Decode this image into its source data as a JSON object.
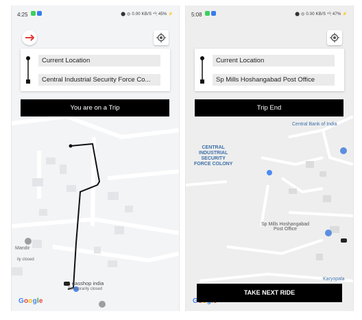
{
  "colors": {
    "accent_red": "#e53935",
    "route": "#111111",
    "blue_dot": "#4c8bf5",
    "map_bg": "#f3f4f6"
  },
  "screen1": {
    "status": {
      "time": "4:25",
      "system": "⬤ ◎ 0.00 KB/S ⁴ᴳ᷊ 45% ⚡"
    },
    "route": {
      "from": "Current Location",
      "to": "Central Industrial Security Force Co..."
    },
    "banner": "You are on a Trip",
    "map_labels": {
      "mandir": "Mandir",
      "ily_closed": "ily closed",
      "shop": "dasshop india",
      "temporarily_closed": "Temporarily closed"
    },
    "google": "Google",
    "icons": {
      "compass": "compass-icon",
      "locate": "my-location-icon"
    }
  },
  "screen2": {
    "status": {
      "time": "5:08",
      "system": "⬤ ◎ 0.00 KB/S ⁴ᴳ᷊ 47% ⚡"
    },
    "route": {
      "from": "Current Location",
      "to": "Sp Mills Hoshangabad Post Office"
    },
    "banner": "Trip End",
    "map_labels": {
      "bank": "Central Bank of India",
      "cisf": "CENTRAL\nINDUSTRIAL\nSECURITY\nFORCE COLONY",
      "post_office": "Sp Mills Hoshangabad\nPost Office",
      "karyopala": "Karyopala"
    },
    "next_ride": "TAKE NEXT RIDE",
    "google": "Google",
    "icons": {
      "locate": "my-location-icon"
    }
  }
}
